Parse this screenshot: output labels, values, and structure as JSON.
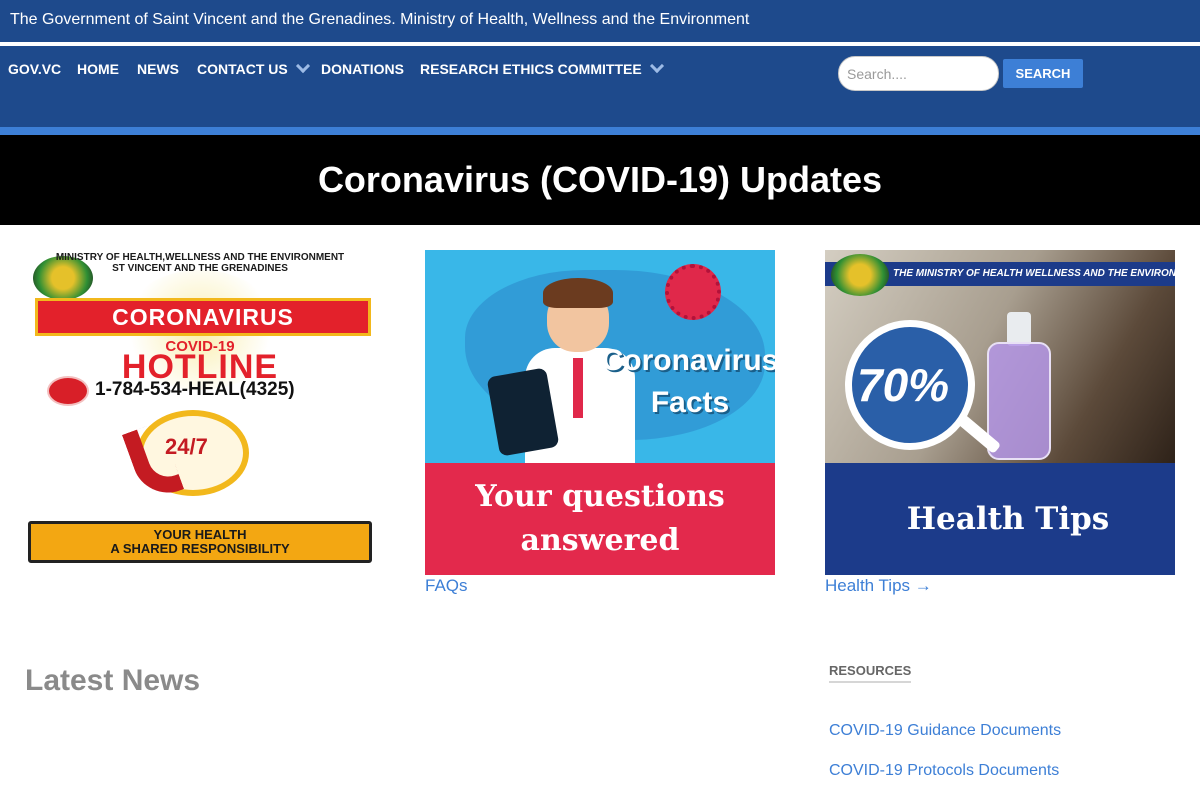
{
  "top_bar": {
    "title": "The Government of Saint Vincent and the Grenadines. Ministry of Health, Wellness and the Environment"
  },
  "nav": {
    "items": [
      {
        "label": "GOV.VC",
        "has_dropdown": false
      },
      {
        "label": "HOME",
        "has_dropdown": false
      },
      {
        "label": "NEWS",
        "has_dropdown": false
      },
      {
        "label": "CONTACT US",
        "has_dropdown": true
      },
      {
        "label": "DONATIONS",
        "has_dropdown": false
      },
      {
        "label": "RESEARCH ETHICS COMMITTEE",
        "has_dropdown": true
      }
    ],
    "search": {
      "placeholder": "Search....",
      "value": "",
      "button_label": "SEARCH"
    }
  },
  "hero": {
    "title": "Coronavirus (COVID-19) Updates"
  },
  "cards": [
    {
      "image": {
        "ministry_line1": "MINISTRY OF HEALTH,WELLNESS AND THE ENVIRONMENT",
        "ministry_line2": "ST VINCENT AND THE GRENADINES",
        "banner": "CORONAVIRUS",
        "sub": "COVID-19",
        "hotline": "HOTLINE",
        "number": "1-784-534-HEAL(4325)",
        "hours": "24/7",
        "slogan_line1": "YOUR HEALTH",
        "slogan_line2": "A SHARED RESPONSIBILITY"
      },
      "link_label": ""
    },
    {
      "image": {
        "facts_line1": "Coronavirus",
        "facts_line2": "Facts",
        "questions_line1": "Your questions",
        "questions_line2": "answered"
      },
      "link_label": "FAQs"
    },
    {
      "image": {
        "header": "THE MINISTRY OF HEALTH WELLNESS AND THE ENVIRONMENT",
        "percent": "70%",
        "tips": "Health Tips"
      },
      "link_label": "Health Tips →"
    }
  ],
  "latest_news": {
    "heading": "Latest News"
  },
  "resources": {
    "heading": "RESOURCES",
    "links": [
      {
        "label": "COVID-19 Guidance Documents"
      },
      {
        "label": "COVID-19 Protocols Documents"
      }
    ]
  },
  "colors": {
    "header_blue": "#1e4a8c",
    "accent_blue": "#3d7fd6",
    "hero_black": "#000000",
    "link_blue": "#3d7fd6"
  }
}
